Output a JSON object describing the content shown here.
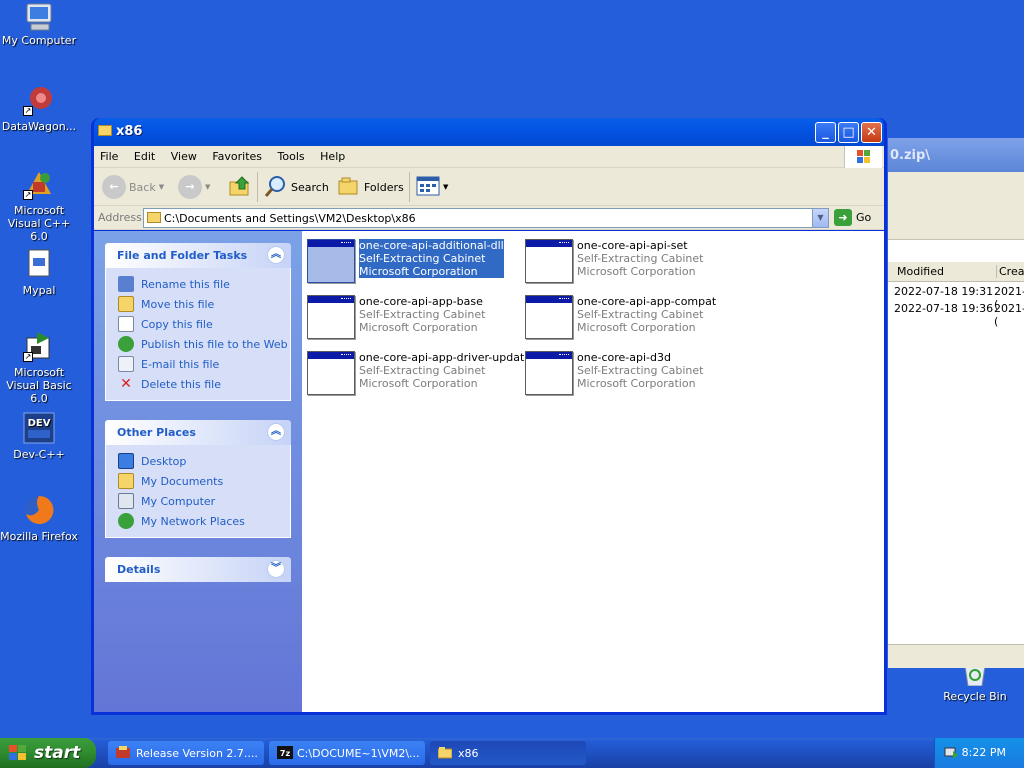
{
  "desktop": {
    "icons": [
      {
        "label": "My Computer"
      },
      {
        "label": "DataWagon..."
      },
      {
        "label": "Microsoft Visual C++ 6.0"
      },
      {
        "label": "Mypal"
      },
      {
        "label": "Microsoft Visual Basic 6.0"
      },
      {
        "label": "Dev-C++"
      },
      {
        "label": "Mozilla Firefox"
      },
      {
        "label": "Recycle Bin"
      }
    ]
  },
  "background_window": {
    "title_fragment": "0.zip\\",
    "columns": [
      "Modified",
      "Creat"
    ],
    "rows": [
      {
        "modified": "2022-07-18 19:31",
        "created": "2021-("
      },
      {
        "modified": "2022-07-18 19:36",
        "created": "2021-("
      }
    ]
  },
  "window": {
    "title": "x86",
    "menu": [
      "File",
      "Edit",
      "View",
      "Favorites",
      "Tools",
      "Help"
    ],
    "toolbar": {
      "back": "Back",
      "search": "Search",
      "folders": "Folders"
    },
    "address": {
      "label": "Address",
      "value": "C:\\Documents and Settings\\VM2\\Desktop\\x86",
      "go": "Go"
    },
    "tasks_panel": {
      "title": "File and Folder Tasks",
      "items": [
        {
          "label": "Rename this file",
          "icon": "rename-icon"
        },
        {
          "label": "Move this file",
          "icon": "move-icon"
        },
        {
          "label": "Copy this file",
          "icon": "copy-icon"
        },
        {
          "label": "Publish this file to the Web",
          "icon": "globe-icon"
        },
        {
          "label": "E-mail this file",
          "icon": "email-icon"
        },
        {
          "label": "Delete this file",
          "icon": "delete-icon"
        }
      ]
    },
    "places_panel": {
      "title": "Other Places",
      "items": [
        {
          "label": "Desktop",
          "icon": "desktop-icon"
        },
        {
          "label": "My Documents",
          "icon": "documents-icon"
        },
        {
          "label": "My Computer",
          "icon": "computer-icon"
        },
        {
          "label": "My Network Places",
          "icon": "network-icon"
        }
      ]
    },
    "details_panel": {
      "title": "Details"
    },
    "files": [
      {
        "name": "one-core-api-additional-dll",
        "type": "Self-Extracting Cabinet",
        "company": "Microsoft Corporation",
        "selected": true
      },
      {
        "name": "one-core-api-api-set",
        "type": "Self-Extracting Cabinet",
        "company": "Microsoft Corporation"
      },
      {
        "name": "one-core-api-app-base",
        "type": "Self-Extracting Cabinet",
        "company": "Microsoft Corporation"
      },
      {
        "name": "one-core-api-app-compat",
        "type": "Self-Extracting Cabinet",
        "company": "Microsoft Corporation"
      },
      {
        "name": "one-core-api-app-driver-update",
        "type": "Self-Extracting Cabinet",
        "company": "Microsoft Corporation"
      },
      {
        "name": "one-core-api-d3d",
        "type": "Self-Extracting Cabinet",
        "company": "Microsoft Corporation"
      }
    ]
  },
  "taskbar": {
    "start": "start",
    "tasks": [
      {
        "label": "Release Version 2.7....",
        "icon": "installer-icon"
      },
      {
        "label": "C:\\DOCUME~1\\VM2\\...",
        "icon": "7zip-icon"
      },
      {
        "label": "x86",
        "icon": "folder-icon",
        "active": true
      }
    ],
    "clock": "8:22 PM"
  }
}
